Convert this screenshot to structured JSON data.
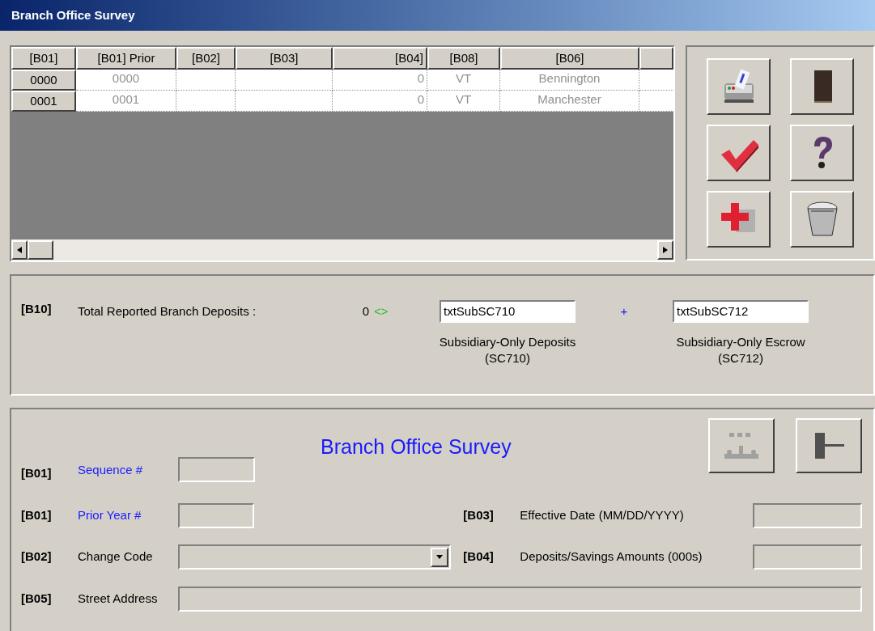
{
  "window": {
    "title": "Branch Office Survey"
  },
  "grid": {
    "columns": [
      "[B01]",
      "[B01] Prior",
      "[B02]",
      "[B03]",
      "[B04]",
      "[B08]",
      "[B06]"
    ],
    "rows": [
      {
        "cells": [
          "0000",
          "0000",
          "",
          "",
          "0",
          "VT",
          "Bennington"
        ]
      },
      {
        "cells": [
          "0001",
          "0001",
          "",
          "",
          "0",
          "VT",
          "Manchester"
        ]
      }
    ]
  },
  "deposits": {
    "code": "[B10]",
    "label": "Total Reported Branch Deposits :",
    "value": "0",
    "compare": "<>",
    "operator": "+",
    "fields": [
      {
        "value": "txtSubSC710",
        "caption": [
          "Subsidiary-Only Deposits",
          "(SC710)"
        ]
      },
      {
        "value": "txtSubSC712",
        "caption": [
          "Subsidiary-Only Escrow",
          "(SC712)"
        ]
      }
    ]
  },
  "form": {
    "title": "Branch Office Survey",
    "buttons": [
      {
        "disabled": true
      },
      {
        "disabled": false
      }
    ],
    "sequence": {
      "code": "[B01]",
      "label": "Sequence #",
      "linked": true
    },
    "rows": [
      {
        "left": {
          "code": "[B01]",
          "label": "Prior Year #",
          "linked": true,
          "kind": "text"
        },
        "right": {
          "code": "[B03]",
          "label": "Effective Date (MM/DD/YYYY)",
          "linked": false,
          "kind": "text"
        }
      },
      {
        "left": {
          "code": "[B02]",
          "label": "Change Code",
          "linked": false,
          "kind": "dropdown"
        },
        "right": {
          "code": "[B04]",
          "label": "Deposits/Savings Amounts (000s)",
          "linked": false,
          "kind": "text"
        }
      }
    ],
    "street": {
      "code": "[B05]",
      "label": "Street Address",
      "linked": false
    }
  }
}
